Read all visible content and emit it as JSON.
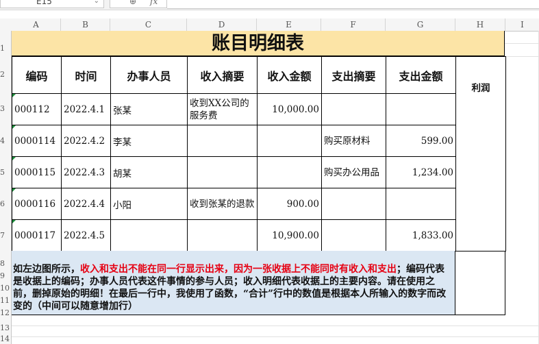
{
  "namebox": {
    "cell": "E15"
  },
  "columns": [
    "A",
    "B",
    "C",
    "D",
    "E",
    "F",
    "G",
    "H",
    "I"
  ],
  "rows": [
    "1",
    "2",
    "3",
    "4",
    "5",
    "6",
    "7",
    "8",
    "9",
    "10",
    "11",
    "12",
    "13",
    "14"
  ],
  "sheet": {
    "title": "账目明细表",
    "headers": [
      "编码",
      "时间",
      "办事人员",
      "收入摘要",
      "收入金额",
      "支出摘要",
      "支出金额",
      "利润"
    ],
    "records": [
      {
        "code": "000112",
        "date": "2022.4.1",
        "person": "张某",
        "income_desc": "收到XX公司的服务费",
        "income_amt": "10,000.00",
        "expense_desc": "",
        "expense_amt": ""
      },
      {
        "code": "0000114",
        "date": "2022.4.2",
        "person": "李某",
        "income_desc": "",
        "income_amt": "",
        "expense_desc": "购买原材料",
        "expense_amt": "599.00"
      },
      {
        "code": "0000115",
        "date": "2022.4.3",
        "person": "胡某",
        "income_desc": "",
        "income_amt": "",
        "expense_desc": "购买办公用品",
        "expense_amt": "1,234.00"
      },
      {
        "code": "0000116",
        "date": "2022.4.4",
        "person": "小阳",
        "income_desc": "收到张某的退款",
        "income_amt": "900.00",
        "expense_desc": "",
        "expense_amt": ""
      },
      {
        "code": "0000117",
        "date": "2022.4.5",
        "person": "",
        "income_desc": "",
        "income_amt": "10,900.00",
        "expense_desc": "",
        "expense_amt": "1,833.00"
      }
    ],
    "note": {
      "part1": "如左边图所示，",
      "part2_red": "收入和支出不能在同一行显示出来，因为一张收据上不能同时有收入和支出",
      "part3": "；编码代表是收据上的编码；办事人员代表这件事情的参与人员；收入明细代表收据上的主要内容。请在使用之前，删掉原始的明细！在最后一行中，我使用了函数，“合计”行中的数值是根据本人所输入的数字而改变的（中间可以随意增加行）"
    }
  },
  "colors": {
    "title_bg": "#fce4a6",
    "note_bg": "#dbe7f3",
    "highlight_red": "#e60012",
    "error_marker": "#1d8f3c"
  }
}
